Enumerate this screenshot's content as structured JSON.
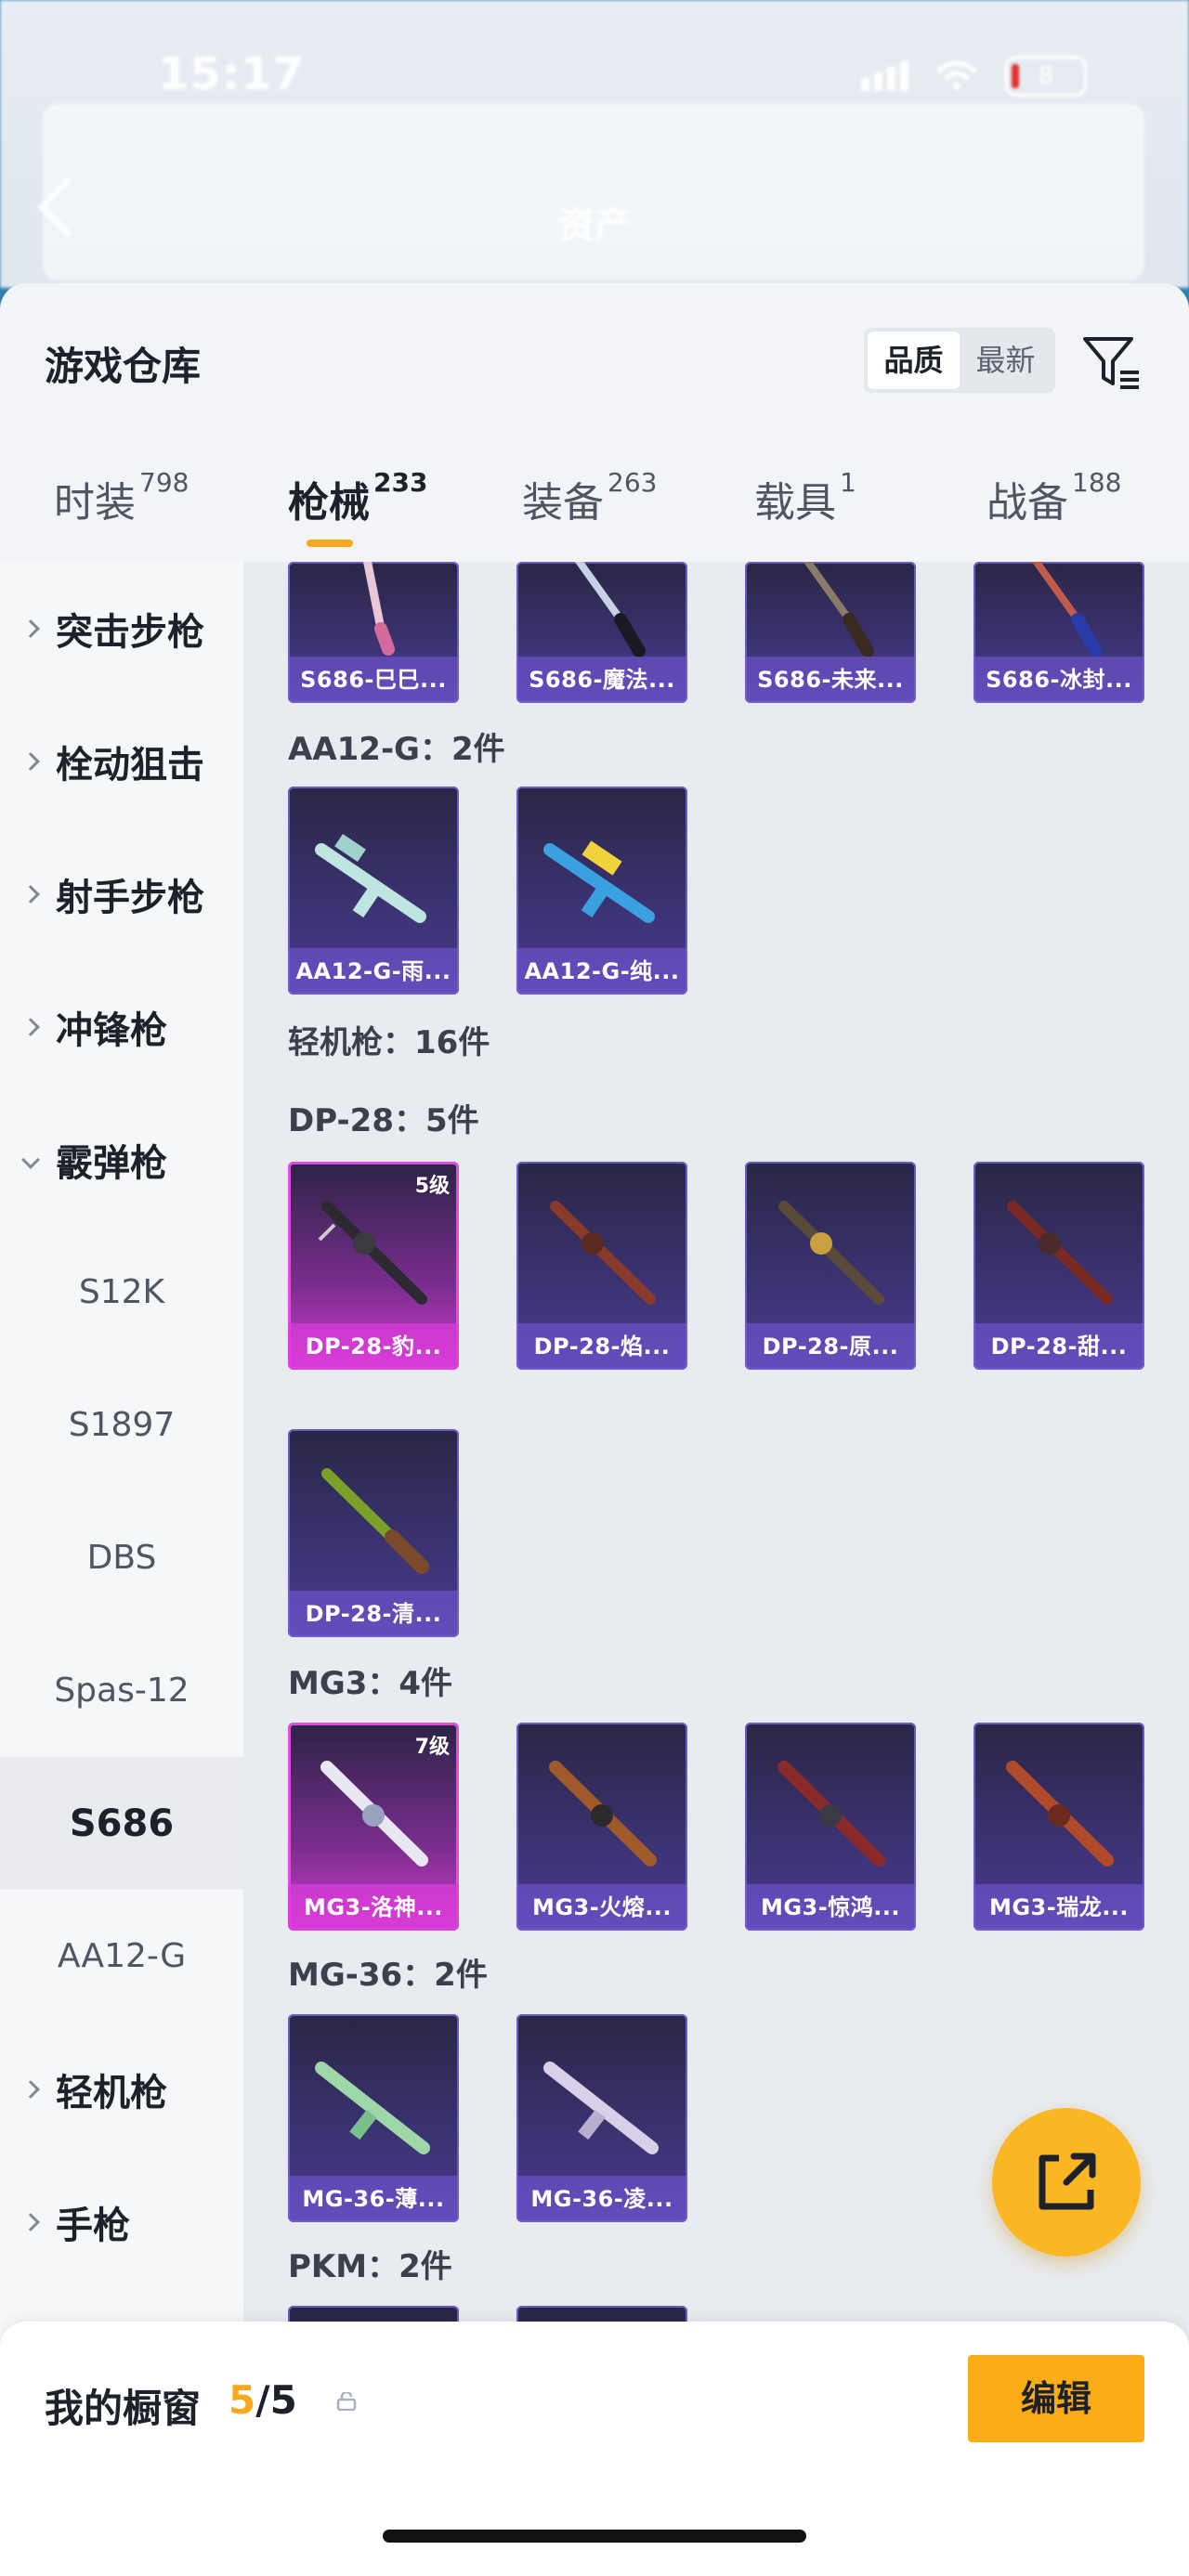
{
  "status_bar": {
    "time": "15:17",
    "battery": "8"
  },
  "header": {
    "title": "资产"
  },
  "sheet": {
    "title": "游戏仓库"
  },
  "sort": {
    "options": [
      "品质",
      "最新"
    ],
    "selected": "品质"
  },
  "tabs": [
    {
      "label": "时装",
      "count": "798"
    },
    {
      "label": "枪械",
      "count": "233",
      "active": true
    },
    {
      "label": "装备",
      "count": "263"
    },
    {
      "label": "载具",
      "count": "1"
    },
    {
      "label": "战备",
      "count": "188"
    }
  ],
  "sidebar": {
    "categories": [
      {
        "label": "突击步枪"
      },
      {
        "label": "栓动狙击"
      },
      {
        "label": "射手步枪"
      },
      {
        "label": "冲锋枪"
      },
      {
        "label": "霰弹枪",
        "expanded": true
      }
    ],
    "sub_items": [
      "S12K",
      "S1897",
      "DBS",
      "Spas-12",
      "S686",
      "AA12-G"
    ],
    "selected_sub": "S686",
    "more_categories": [
      {
        "label": "轻机枪"
      },
      {
        "label": "手枪"
      }
    ]
  },
  "content": {
    "s686_items": [
      "S686-巳巳...",
      "S686-魔法...",
      "S686-未来...",
      "S686-冰封..."
    ],
    "aa12_group": {
      "title": "AA12-G：2件",
      "items": [
        "AA12-G-雨...",
        "AA12-G-纯..."
      ]
    },
    "lmg_section": {
      "title": "轻机枪：16件"
    },
    "dp28_group": {
      "title": "DP-28：5件",
      "items": [
        "DP-28-豹...",
        "DP-28-焰...",
        "DP-28-原...",
        "DP-28-甜...",
        "DP-28-清..."
      ],
      "level_badge": "5级"
    },
    "mg3_group": {
      "title": "MG3：4件",
      "items": [
        "MG3-洛神...",
        "MG3-火熔...",
        "MG3-惊鸿...",
        "MG3-瑞龙..."
      ],
      "level_badge": "7级"
    },
    "mg36_group": {
      "title": "MG-36：2件",
      "items": [
        "MG-36-薄...",
        "MG-36-凌..."
      ]
    },
    "pkm_group": {
      "title": "PKM：2件"
    }
  },
  "colors": {
    "accent": "#f7a81b",
    "epic": "#d23bd0",
    "rare": "#4b3b92"
  },
  "footer": {
    "title": "我的橱窗",
    "count_current": "5",
    "count_sep": "/",
    "count_total": "5",
    "edit_label": "编辑"
  }
}
